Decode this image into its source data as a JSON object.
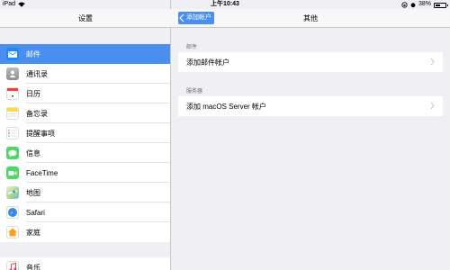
{
  "status_bar": {
    "device": "iPad",
    "time": "上午10:43",
    "battery_text": "38%",
    "battery_level": 0.38
  },
  "left_nav": {
    "title": "设置"
  },
  "settings_items": [
    {
      "label": "邮件",
      "icon": "mail-icon",
      "color": "#1e88f5",
      "selected": true
    },
    {
      "label": "通讯录",
      "icon": "contacts-icon",
      "color": "#a8a8ae",
      "selected": false
    },
    {
      "label": "日历",
      "icon": "calendar-icon",
      "color": "#ffffff",
      "selected": false
    },
    {
      "label": "备忘录",
      "icon": "notes-icon",
      "color": "#ffd84a",
      "selected": false
    },
    {
      "label": "提醒事项",
      "icon": "reminders-icon",
      "color": "#ffffff",
      "selected": false
    },
    {
      "label": "信息",
      "icon": "messages-icon",
      "color": "#4cd964",
      "selected": false
    },
    {
      "label": "FaceTime",
      "icon": "facetime-icon",
      "color": "#4cd964",
      "selected": false
    },
    {
      "label": "地图",
      "icon": "maps-icon",
      "color": "#7fc96a",
      "selected": false
    },
    {
      "label": "Safari",
      "icon": "safari-icon",
      "color": "#2a8ef0",
      "selected": false
    },
    {
      "label": "家庭",
      "icon": "home-icon",
      "color": "#ff9f1a",
      "selected": false
    }
  ],
  "settings_items_2": [
    {
      "label": "音乐",
      "icon": "music-icon",
      "color": "#fc3c5e"
    }
  ],
  "right_nav": {
    "back_label": "添加帐户",
    "title": "其他"
  },
  "sections": [
    {
      "header": "邮件",
      "cell": "添加邮件帐户"
    },
    {
      "header": "服务器",
      "cell": "添加 macOS Server 帐户"
    }
  ]
}
